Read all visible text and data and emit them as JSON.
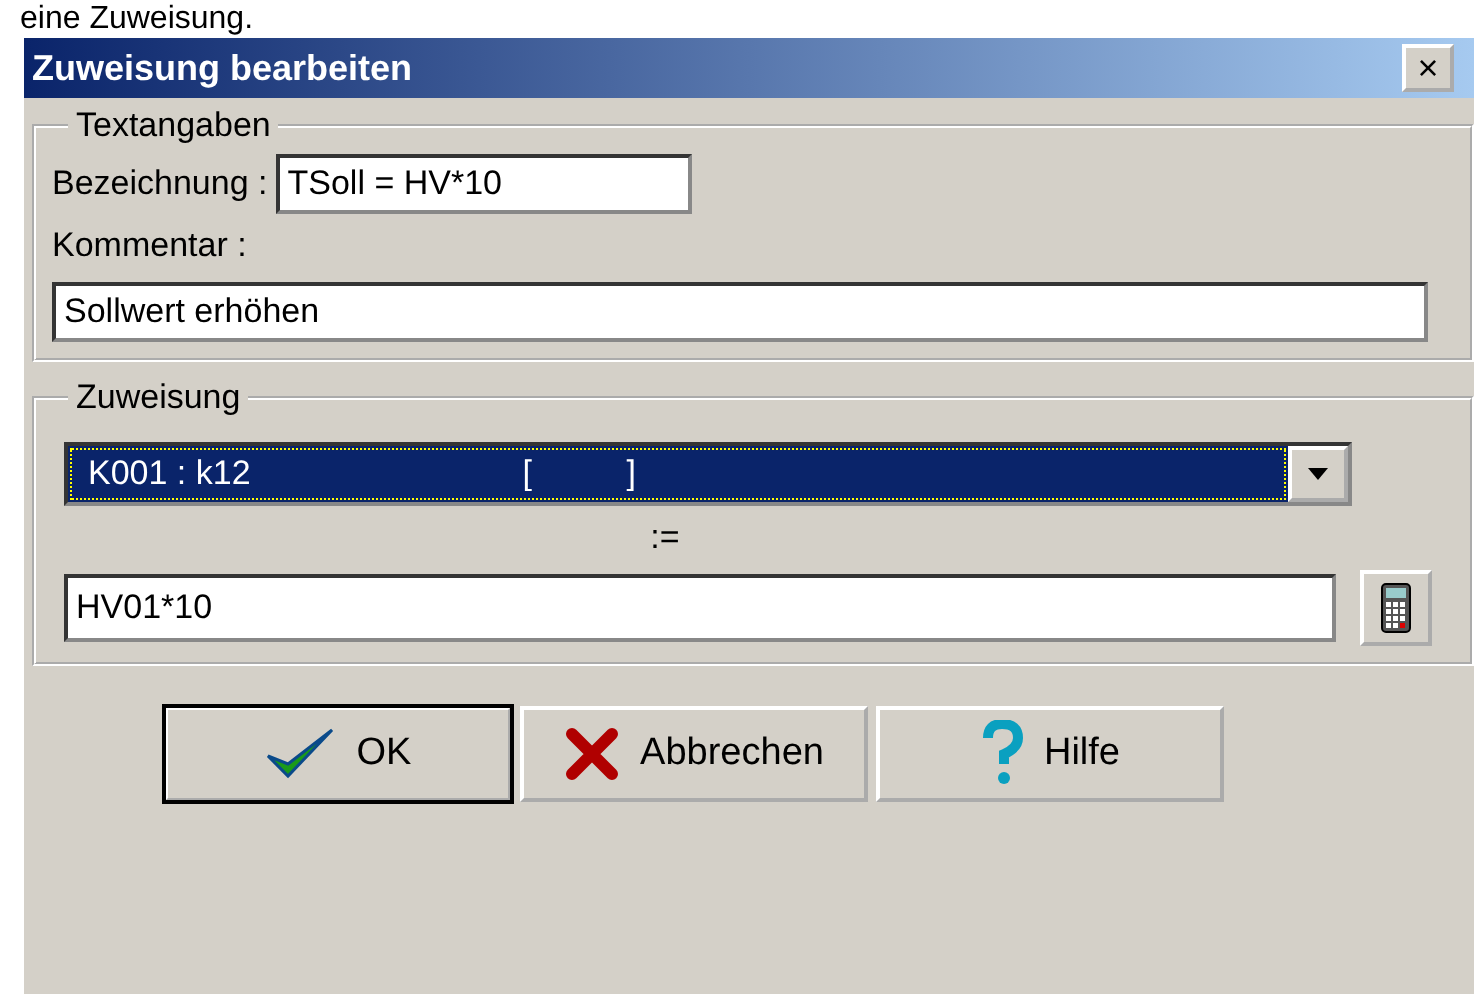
{
  "caption": "eine Zuweisung.",
  "window": {
    "title": "Zuweisung bearbeiten",
    "close": "×"
  },
  "textangaben": {
    "legend": "Textangaben",
    "bezeichnung_label": "Bezeichnung :",
    "bezeichnung_value": "TSoll = HV*10",
    "kommentar_label": "Kommentar :",
    "kommentar_value": "Sollwert erhöhen"
  },
  "zuweisung": {
    "legend": "Zuweisung",
    "target": {
      "name": "K001 : k12",
      "bracket": "[          ]",
      "selected": true
    },
    "operator": ":=",
    "expression": "HV01*10"
  },
  "buttons": [
    {
      "kind": "ok",
      "label": "OK",
      "default": true
    },
    {
      "kind": "cancel",
      "label": "Abbrechen",
      "default": false
    },
    {
      "kind": "help",
      "label": "Hilfe",
      "default": false
    }
  ]
}
